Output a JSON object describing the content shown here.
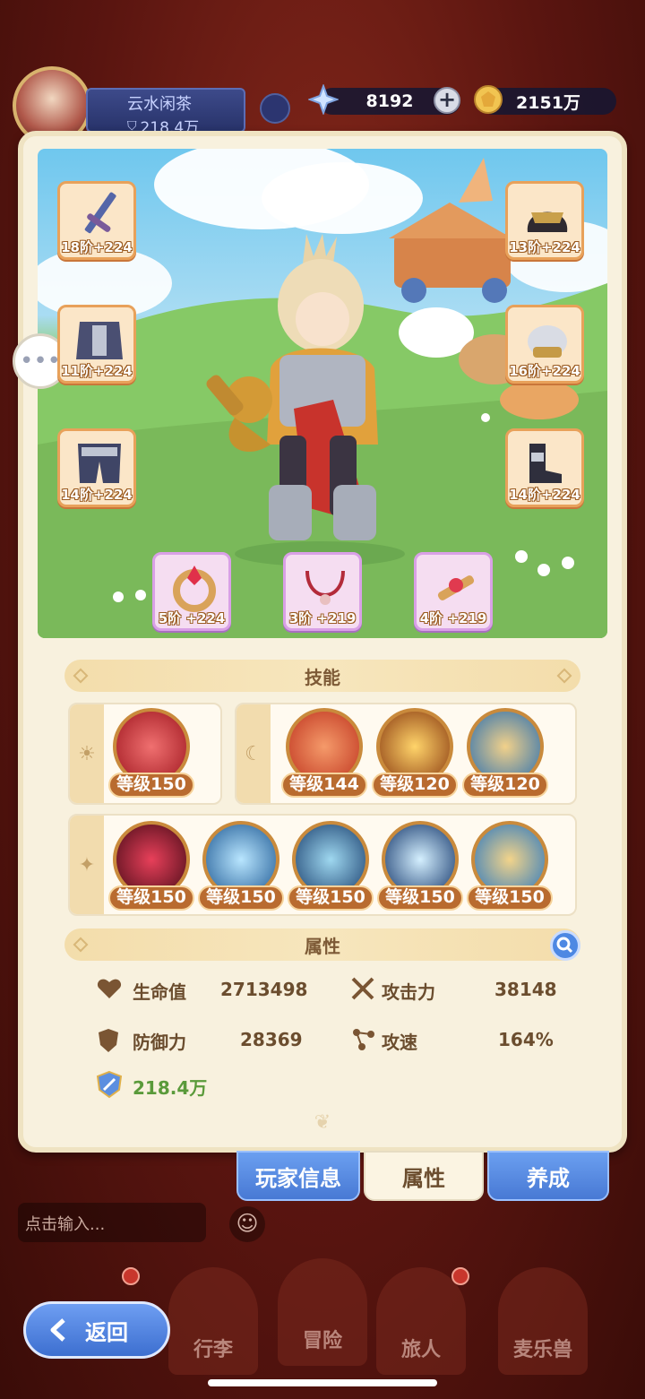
{
  "player": {
    "name": "云水闲茶",
    "power": "218.4万"
  },
  "resources": {
    "crystals": "8192",
    "gold": "2151万"
  },
  "equipment": {
    "left": [
      {
        "name": "sword",
        "level": "18阶",
        "bonus": "+224"
      },
      {
        "name": "chest-armor",
        "level": "11阶",
        "bonus": "+224"
      },
      {
        "name": "leg-armor",
        "level": "14阶",
        "bonus": "+224"
      }
    ],
    "right": [
      {
        "name": "helmet",
        "level": "13阶",
        "bonus": "+224"
      },
      {
        "name": "gauntlet",
        "level": "16阶",
        "bonus": "+224"
      },
      {
        "name": "boots",
        "level": "14阶",
        "bonus": "+224"
      }
    ],
    "bottom": [
      {
        "name": "ring",
        "level": "5阶",
        "bonus": "+224"
      },
      {
        "name": "necklace",
        "level": "3阶",
        "bonus": "+219"
      },
      {
        "name": "amulet",
        "level": "4阶",
        "bonus": "+219"
      }
    ]
  },
  "skills": {
    "header": "技能",
    "sun_group": [
      {
        "level": "等级150",
        "icon": "fire-warrior"
      }
    ],
    "moon_group": [
      {
        "level": "等级144",
        "icon": "fire-dash"
      },
      {
        "level": "等级120",
        "icon": "golden-slash"
      },
      {
        "level": "等级120",
        "icon": "lion-roar"
      }
    ],
    "star_group": [
      {
        "level": "等级150",
        "icon": "shadow-rage"
      },
      {
        "level": "等级150",
        "icon": "ice-sword"
      },
      {
        "level": "等级150",
        "icon": "frost-wave"
      },
      {
        "level": "等级150",
        "icon": "lightning-burst"
      },
      {
        "level": "等级150",
        "icon": "aqua-blade"
      }
    ]
  },
  "attributes": {
    "header": "属性",
    "hp_label": "生命值",
    "hp": "2713498",
    "atk_label": "攻击力",
    "atk": "38148",
    "def_label": "防御力",
    "def": "28369",
    "spd_label": "攻速",
    "spd": "164%",
    "power": "218.4万"
  },
  "tabs": {
    "player_info": "玩家信息",
    "attributes": "属性",
    "develop": "养成"
  },
  "chat": {
    "placeholder": "点击输入..."
  },
  "nav": {
    "luggage": "行李",
    "adventure": "冒险",
    "traveler": "旅人",
    "mailer": "麦乐兽",
    "back": "返回"
  },
  "colors": {
    "accent_blue": "#4879d4",
    "panel": "#f8f1de",
    "gold_text": "#6b4d2e",
    "power_green": "#5a9a3a"
  }
}
